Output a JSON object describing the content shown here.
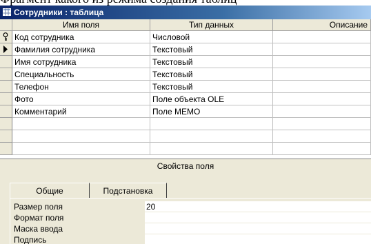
{
  "caption": "Фрагмент какого из режима создания таблиц",
  "window": {
    "title": "Сотрудники : таблица"
  },
  "columns": [
    "Имя поля",
    "Тип данных",
    "Описание"
  ],
  "rows": [
    {
      "name": "Код сотрудника",
      "type": "Числовой",
      "description": "",
      "indicator": "key-icon"
    },
    {
      "name": "Фамилия сотрудника",
      "type": "Текстовый",
      "description": "",
      "indicator": "current-row-arrow-icon"
    },
    {
      "name": "Имя сотрудника",
      "type": "Текстовый",
      "description": "",
      "indicator": ""
    },
    {
      "name": "Специальность",
      "type": "Текстовый",
      "description": "",
      "indicator": ""
    },
    {
      "name": "Телефон",
      "type": "Текстовый",
      "description": "",
      "indicator": ""
    },
    {
      "name": "Фото",
      "type": "Поле объекта OLE",
      "description": "",
      "indicator": ""
    },
    {
      "name": "Комментарий",
      "type": "Поле MEMO",
      "description": "",
      "indicator": ""
    },
    {
      "name": "",
      "type": "",
      "description": "",
      "indicator": ""
    },
    {
      "name": "",
      "type": "",
      "description": "",
      "indicator": ""
    },
    {
      "name": "",
      "type": "",
      "description": "",
      "indicator": ""
    }
  ],
  "field_properties": {
    "header": "Свойства поля",
    "tabs": [
      "Общие",
      "Подстановка"
    ],
    "active_tab": "Общие",
    "properties": [
      {
        "label": "Размер поля",
        "value": "20"
      },
      {
        "label": "Формат поля",
        "value": ""
      },
      {
        "label": "Маска ввода",
        "value": ""
      },
      {
        "label": "Подпись",
        "value": ""
      }
    ]
  },
  "colors": {
    "titlebar_start": "#0a246a",
    "titlebar_end": "#a6caf0",
    "chrome": "#ece9d8"
  }
}
